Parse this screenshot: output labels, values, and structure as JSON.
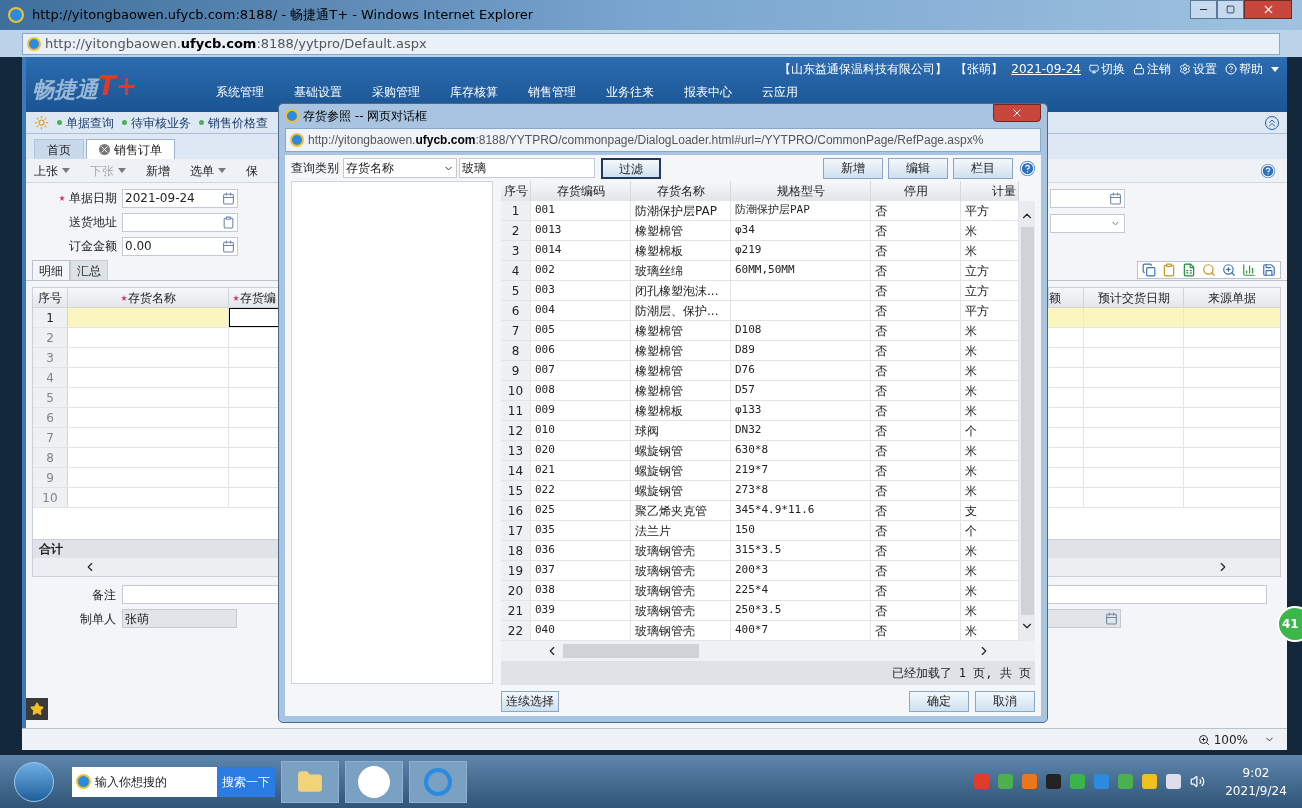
{
  "browser": {
    "title": "http://yitongbaowen.ufycb.com:8188/ - 畅捷通T+ - Windows Internet Explorer",
    "address": "http://yitongbaowen.**ufycb.com**:8188/yytpro/Default.aspx",
    "zoom": "100%"
  },
  "app": {
    "logo": "畅捷通",
    "logo_mark": "T+",
    "company": "【山东益通保温科技有限公司】",
    "user": "【张萌】",
    "date": "2021-09-24",
    "links": [
      "切换",
      "注销",
      "设置",
      "帮助"
    ],
    "menu": [
      "系统管理",
      "基础设置",
      "采购管理",
      "库存核算",
      "销售管理",
      "业务往来",
      "报表中心",
      "云应用"
    ]
  },
  "shortcuts": [
    "单据查询",
    "待审核业务",
    "销售价格查"
  ],
  "tabs": [
    {
      "label": "首页",
      "selected": false
    },
    {
      "label": "销售订单",
      "selected": true
    }
  ],
  "toolbar": [
    {
      "label": "上张",
      "dropdown": true,
      "disabled": false
    },
    {
      "label": "下张",
      "dropdown": true,
      "disabled": true
    },
    {
      "label": "新增",
      "dropdown": false,
      "disabled": false
    },
    {
      "label": "选单",
      "dropdown": true,
      "disabled": false
    },
    {
      "label": "保",
      "dropdown": false,
      "disabled": false
    }
  ],
  "form": [
    {
      "label": "单据日期",
      "required": true,
      "value": "2021-09-24",
      "kind": "date"
    },
    {
      "label": "送货地址",
      "required": false,
      "kind": "lookup"
    },
    {
      "label": "订金金额",
      "required": false,
      "value": "0.00",
      "kind": "date"
    }
  ],
  "detail_tabs": [
    {
      "label": "明细",
      "selected": true
    },
    {
      "label": "汇总",
      "selected": false
    }
  ],
  "grid": {
    "columns": [
      {
        "label": "序号",
        "required": false
      },
      {
        "label": "存货名称",
        "required": true
      },
      {
        "label": "存货编",
        "required": true
      }
    ],
    "columns_right": [
      "额",
      "预计交货日期",
      "来源单据"
    ],
    "rows": [
      {
        "no": "1",
        "selected": true
      },
      {
        "no": "2",
        "selected": false
      },
      {
        "no": "3",
        "selected": false
      },
      {
        "no": "4",
        "selected": false
      },
      {
        "no": "5",
        "selected": false
      },
      {
        "no": "6",
        "selected": false
      },
      {
        "no": "7",
        "selected": false
      },
      {
        "no": "8",
        "selected": false
      },
      {
        "no": "9",
        "selected": false
      },
      {
        "no": "10",
        "selected": false
      }
    ],
    "total_label": "合计"
  },
  "footer_form": {
    "note_label": "备注",
    "maker_label": "制单人",
    "maker": "张萌"
  },
  "badge": "41",
  "dialog": {
    "title": "存货参照 -- 网页对话框",
    "address": "http://yitongbaowen.**ufycb.com**:8188/YYTPRO/commonpage/DialogLoader.html#url=/YYTPRO/CommonPage/RefPage.aspx%",
    "query_label": "查询类别",
    "query_type": "存货名称",
    "query_value": "玻璃",
    "filter_button": {
      "label": "过滤",
      "focused": true
    },
    "actions": [
      "新增",
      "编辑",
      "栏目"
    ],
    "columns": [
      "序号",
      "存货编码",
      "存货名称",
      "规格型号",
      "停用",
      "计量"
    ],
    "rows": [
      [
        "1",
        "001",
        "防潮保护层PAP",
        "防潮保护层PAP",
        "否",
        "平方"
      ],
      [
        "2",
        "0013",
        "橡塑棉管",
        "φ34",
        "否",
        "米"
      ],
      [
        "3",
        "0014",
        "橡塑棉板",
        "φ219",
        "否",
        "米"
      ],
      [
        "4",
        "002",
        "玻璃丝绵",
        "60MM,50MM",
        "否",
        "立方"
      ],
      [
        "5",
        "003",
        "闭孔橡塑泡沫...",
        "",
        "否",
        "立方"
      ],
      [
        "6",
        "004",
        "防潮层、保护...",
        "",
        "否",
        "平方"
      ],
      [
        "7",
        "005",
        "橡塑棉管",
        "D108",
        "否",
        "米"
      ],
      [
        "8",
        "006",
        "橡塑棉管",
        "D89",
        "否",
        "米"
      ],
      [
        "9",
        "007",
        "橡塑棉管",
        "D76",
        "否",
        "米"
      ],
      [
        "10",
        "008",
        "橡塑棉管",
        "D57",
        "否",
        "米"
      ],
      [
        "11",
        "009",
        "橡塑棉板",
        "φ133",
        "否",
        "米"
      ],
      [
        "12",
        "010",
        "球阀",
        "DN32",
        "否",
        "个"
      ],
      [
        "13",
        "020",
        "螺旋钢管",
        "630*8",
        "否",
        "米"
      ],
      [
        "14",
        "021",
        "螺旋钢管",
        "219*7",
        "否",
        "米"
      ],
      [
        "15",
        "022",
        "螺旋钢管",
        "273*8",
        "否",
        "米"
      ],
      [
        "16",
        "025",
        "聚乙烯夹克管",
        "345*4.9*11.6",
        "否",
        "支"
      ],
      [
        "17",
        "035",
        "法兰片",
        "150",
        "否",
        "个"
      ],
      [
        "18",
        "036",
        "玻璃钢管壳",
        "315*3.5",
        "否",
        "米"
      ],
      [
        "19",
        "037",
        "玻璃钢管壳",
        "200*3",
        "否",
        "米"
      ],
      [
        "20",
        "038",
        "玻璃钢管壳",
        "225*4",
        "否",
        "米"
      ],
      [
        "21",
        "039",
        "玻璃钢管壳",
        "250*3.5",
        "否",
        "米"
      ],
      [
        "22",
        "040",
        "玻璃钢管壳",
        "400*7",
        "否",
        "米"
      ]
    ],
    "status": "已经加载了 1 页, 共 页",
    "continue_button": "连续选择",
    "ok_button": "确定",
    "cancel_button": "取消"
  },
  "taskbar": {
    "search_placeholder": "输入你想搜的",
    "search_button": "搜索一下",
    "time": "9:02",
    "date": "2021/9/24"
  }
}
